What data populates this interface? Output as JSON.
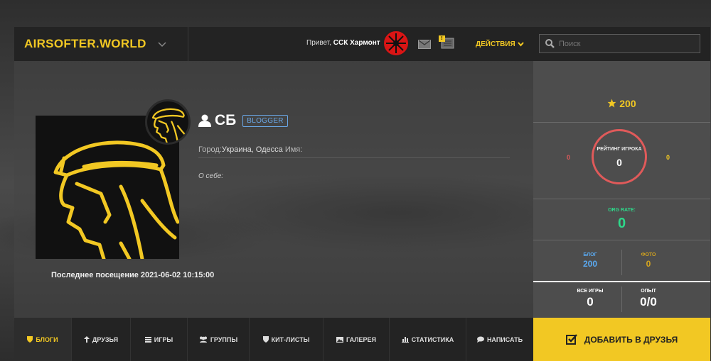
{
  "header": {
    "logo": "AIRSOFTER.WORLD",
    "greeting_prefix": "Привет,",
    "greeting_user": "ССК Хармонт",
    "actions_label": "ДЕЙСТВИЯ",
    "notif_badge": "!",
    "search_placeholder": "Поиск"
  },
  "profile": {
    "name": "СБ",
    "role_badge": "BLOGGER",
    "city_label": "Город:",
    "city_value": "Украина, Одесса",
    "name_label": " Имя:",
    "about": "О себе:",
    "last_visit": "Последнее посещение 2021-06-02 10:15:00"
  },
  "stats": {
    "rating": "200",
    "player_rating_label": "РЕЙТИНГ ИГРОКА",
    "player_rating_value": "0",
    "rating_left": "0",
    "rating_right": "0",
    "org_rate_label": "ORG RATE:",
    "org_rate_value": "0",
    "blog_label": "БЛОГ",
    "blog_value": "200",
    "photo_label": "ФОТО",
    "photo_value": "0",
    "games_label": "ВСЕ ИГРЫ",
    "games_value": "0",
    "exp_label": "ОПЫТ",
    "exp_value": "0/0"
  },
  "nav": {
    "items": [
      {
        "label": "БЛОГИ"
      },
      {
        "label": "ДРУЗЬЯ"
      },
      {
        "label": "ИГРЫ"
      },
      {
        "label": "ГРУППЫ"
      },
      {
        "label": "КИТ-ЛИСТЫ"
      },
      {
        "label": "ГАЛЕРЕЯ"
      },
      {
        "label": "СТАТИСТИКА"
      },
      {
        "label": "НАПИСАТЬ"
      }
    ],
    "add_friend": "ДОБАВИТЬ В ДРУЗЬЯ"
  },
  "colors": {
    "accent": "#f2c823",
    "rating_ring": "#e05a5a",
    "org_green": "#2ed88a",
    "blog_blue": "#5aa9f0",
    "photo_gold": "#d4a41e"
  }
}
